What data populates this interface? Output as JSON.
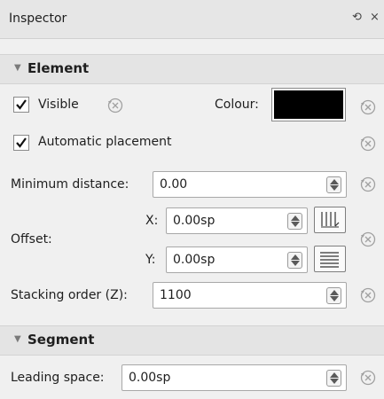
{
  "panel": {
    "title": "Inspector",
    "float_glyph": "⟲",
    "close_glyph": "×"
  },
  "element": {
    "section_label": "Element",
    "visible_label": "Visible",
    "visible_checked": true,
    "colour_label": "Colour:",
    "colour_value": "#000000",
    "auto_place_label": "Automatic placement",
    "auto_place_checked": true,
    "min_distance_label": "Minimum distance:",
    "min_distance_value": "0.00",
    "offset_label": "Offset:",
    "offset_x_label": "X:",
    "offset_x_value": "0.00sp",
    "offset_y_label": "Y:",
    "offset_y_value": "0.00sp",
    "stacking_label": "Stacking order (Z):",
    "stacking_value": "1100"
  },
  "segment": {
    "section_label": "Segment",
    "leading_label": "Leading space:",
    "leading_value": "0.00sp"
  },
  "icons": {
    "reset": "reset-to-default-icon",
    "checkmark": "checkmark-icon",
    "section_arrow": "expand-arrow-icon",
    "snap_x": "snap-to-grid-horizontal-icon",
    "snap_y": "snap-to-grid-vertical-icon"
  }
}
